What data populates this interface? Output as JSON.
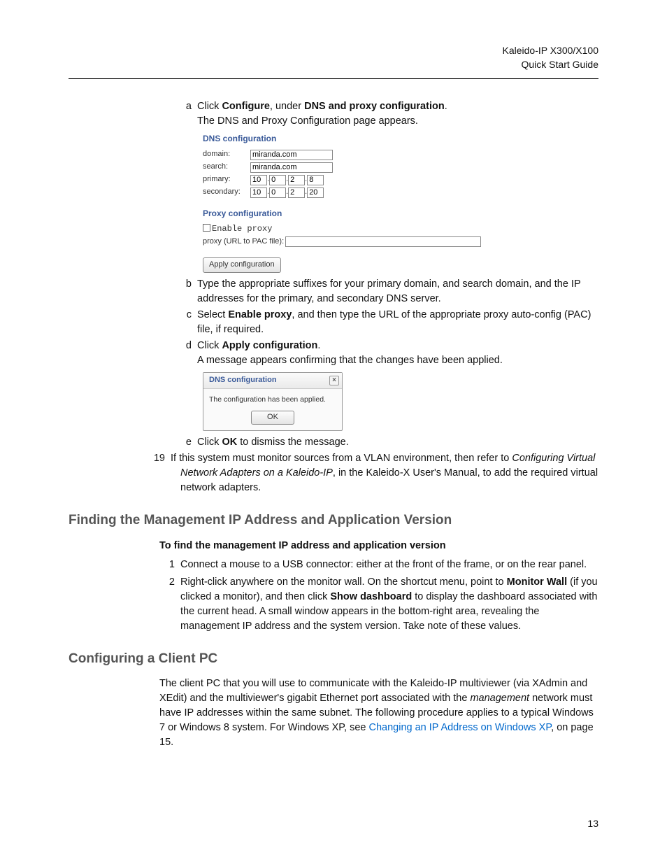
{
  "header": {
    "product": "Kaleido-IP X300/X100",
    "doc": "Quick Start Guide"
  },
  "stepA": {
    "letter": "a",
    "pre": "Click ",
    "b1": "Configure",
    "mid": ", under ",
    "b2": "DNS and proxy configuration",
    "post": ".",
    "line2": "The DNS and Proxy Configuration page appears."
  },
  "config": {
    "title": "DNS configuration",
    "domain_label": "domain:",
    "domain_value": "miranda.com",
    "search_label": "search:",
    "search_value": "miranda.com",
    "primary_label": "primary:",
    "primary": [
      "10",
      "0",
      "2",
      "8"
    ],
    "secondary_label": "secondary:",
    "secondary": [
      "10",
      "0",
      "2",
      "20"
    ],
    "proxy_title": "Proxy configuration",
    "enable_proxy": "Enable proxy",
    "pac_label": "proxy (URL to PAC file):",
    "apply": "Apply configuration"
  },
  "stepB": {
    "letter": "b",
    "text": "Type the appropriate suffixes for your primary domain, and search domain, and the IP addresses for the primary, and secondary DNS server."
  },
  "stepC": {
    "letter": "c",
    "pre": "Select ",
    "b1": "Enable proxy",
    "post": ", and then type the URL of the appropriate proxy auto-config (PAC) file, if required."
  },
  "stepD": {
    "letter": "d",
    "pre": "Click ",
    "b1": "Apply configuration",
    "post": ".",
    "line2": "A message appears confirming that the changes have been applied."
  },
  "dialog": {
    "title": "DNS configuration",
    "msg": "The configuration has been applied.",
    "ok": "OK"
  },
  "stepE": {
    "letter": "e",
    "pre": "Click ",
    "b1": "OK",
    "post": " to dismiss the message."
  },
  "step19": {
    "num": "19",
    "pre": "If this system must monitor sources from a VLAN environment, then refer to ",
    "i1": "Configuring Virtual Network Adapters on a Kaleido-IP",
    "post": ", in the Kaleido-X User's Manual, to add the required virtual network adapters."
  },
  "section1": {
    "title": "Finding the Management IP Address and Application Version",
    "subhead": "To find the management IP address and application version"
  },
  "s1step1": {
    "num": "1",
    "text": "Connect a mouse to a USB connector: either at the front of the frame, or on the rear panel."
  },
  "s1step2": {
    "num": "2",
    "pre": "Right-click anywhere on the monitor wall. On the shortcut menu, point to ",
    "b1": "Monitor Wall",
    "mid": " (if you clicked a monitor), and then click ",
    "b2": "Show dashboard",
    "post": " to display the dashboard associated with the current head. A small window appears in the bottom-right area, revealing the management IP address and the system version. Take note of these values."
  },
  "section2": {
    "title": "Configuring a Client PC",
    "para_pre": "The client PC that you will use to communicate with the Kaleido-IP multiviewer (via XAdmin and XEdit) and the multiviewer's gigabit Ethernet port associated with the ",
    "para_i": "management",
    "para_mid": " network must have IP addresses within the same subnet. The following procedure applies to a typical Windows 7 or Windows 8 system. For Windows XP, see ",
    "para_link": "Changing an IP Address on Windows XP",
    "para_post": ", on page 15."
  },
  "pagenum": "13"
}
